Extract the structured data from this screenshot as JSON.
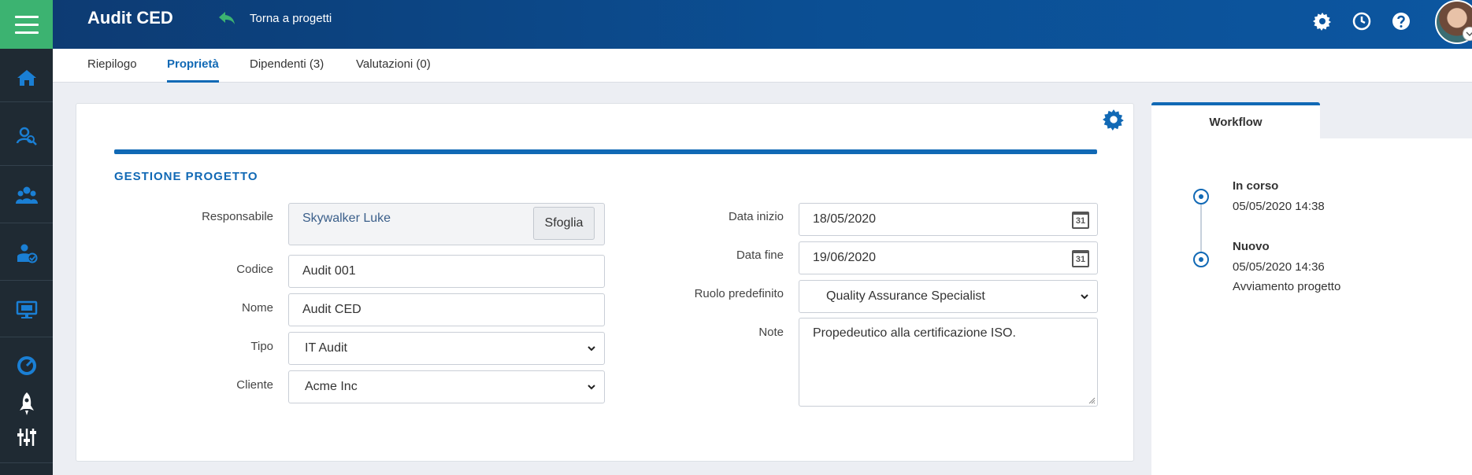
{
  "header": {
    "title": "Audit CED",
    "back_label": "Torna a progetti"
  },
  "tabs": [
    {
      "label": "Riepilogo"
    },
    {
      "label": "Proprietà"
    },
    {
      "label": "Dipendenti (3)"
    },
    {
      "label": "Valutazioni (0)"
    }
  ],
  "section": {
    "title": "GESTIONE PROGETTO"
  },
  "form": {
    "responsabile": {
      "label": "Responsabile",
      "value": "Skywalker Luke",
      "button": "Sfoglia"
    },
    "codice": {
      "label": "Codice",
      "value": "Audit 001"
    },
    "nome": {
      "label": "Nome",
      "value": "Audit CED"
    },
    "tipo": {
      "label": "Tipo",
      "value": "IT Audit"
    },
    "cliente": {
      "label": "Cliente",
      "value": "Acme Inc"
    },
    "data_inizio": {
      "label": "Data inizio",
      "value": "18/05/2020",
      "icon_text": "31"
    },
    "data_fine": {
      "label": "Data fine",
      "value": "19/06/2020",
      "icon_text": "31"
    },
    "ruolo": {
      "label": "Ruolo predefinito",
      "value": "Quality Assurance Specialist"
    },
    "note": {
      "label": "Note",
      "value": "Propedeutico alla certificazione ISO."
    }
  },
  "workflow": {
    "tab_label": "Workflow",
    "steps": [
      {
        "status": "In corso",
        "timestamp": "05/05/2020 14:38",
        "note": ""
      },
      {
        "status": "Nuovo",
        "timestamp": "05/05/2020 14:36",
        "note": "Avviamento progetto"
      }
    ]
  },
  "colors": {
    "accent": "#1169b5",
    "sidebar": "#1f2a33",
    "menu_button": "#3cb371",
    "header_dark": "#0d3b73"
  },
  "icons": {
    "sidebar": [
      "home-icon",
      "search-user-icon",
      "group-icon",
      "user-check-icon",
      "monitor-icon",
      "gauge-icon",
      "rocket-icon",
      "sliders-icon"
    ],
    "header": [
      "gear-icon",
      "clock-icon",
      "help-icon"
    ]
  }
}
